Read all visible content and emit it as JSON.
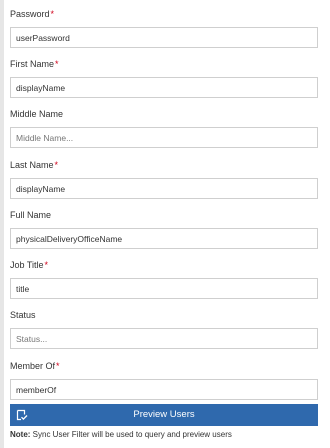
{
  "form": {
    "fields": [
      {
        "label": "Password",
        "required": true,
        "value": "userPassword",
        "placeholder": ""
      },
      {
        "label": "First Name",
        "required": true,
        "value": "displayName",
        "placeholder": ""
      },
      {
        "label": "Middle Name",
        "required": false,
        "value": "",
        "placeholder": "Middle Name..."
      },
      {
        "label": "Last Name",
        "required": true,
        "value": "displayName",
        "placeholder": ""
      },
      {
        "label": "Full Name",
        "required": false,
        "value": "physicalDeliveryOfficeName",
        "placeholder": ""
      },
      {
        "label": "Job Title",
        "required": true,
        "value": "title",
        "placeholder": ""
      },
      {
        "label": "Status",
        "required": false,
        "value": "",
        "placeholder": "Status..."
      },
      {
        "label": "Member Of",
        "required": true,
        "value": "memberOf",
        "placeholder": ""
      }
    ],
    "required_marker": "*"
  },
  "preview_button": {
    "label": "Preview Users",
    "icon": "preview-users-icon"
  },
  "note": {
    "prefix": "Note:",
    "text": " Sync User Filter will be used to query and preview users"
  },
  "colors": {
    "accent": "#2f69ad",
    "required": "#d0021b",
    "border": "#cfcfcf"
  }
}
